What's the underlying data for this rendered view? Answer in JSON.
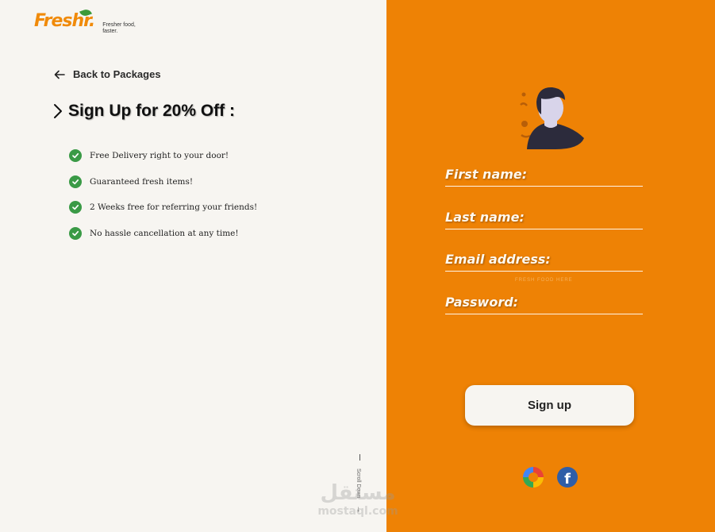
{
  "brand": {
    "name": "Freshr.",
    "tagline": "Fresher food, faster."
  },
  "nav": {
    "back_label": "Back to Packages"
  },
  "offer": {
    "title": "Sign Up for 20% Off :",
    "benefits": [
      "Free Delivery right to your door!",
      "Guaranteed fresh items!",
      "2 Weeks free for referring your friends!",
      "No hassle cancellation at any time!"
    ]
  },
  "scroll": {
    "label": "Scroll Down"
  },
  "form": {
    "first_name_label": "First name:",
    "last_name_label": "Last name:",
    "email_label": "Email address:",
    "email_hint": "FRESH FOOD HERE",
    "password_label": "Password:",
    "submit_label": "Sign up"
  },
  "social": {
    "google_icon": "google-icon",
    "facebook_icon": "facebook-icon",
    "facebook_glyph": "f"
  },
  "watermark": {
    "arabic": "مستقل",
    "latin": "mostaql.com"
  },
  "colors": {
    "accent_orange": "#ee8205",
    "background_cream": "#f7f5f1",
    "check_green": "#3a9a46",
    "facebook_blue": "#2f5ea8"
  }
}
